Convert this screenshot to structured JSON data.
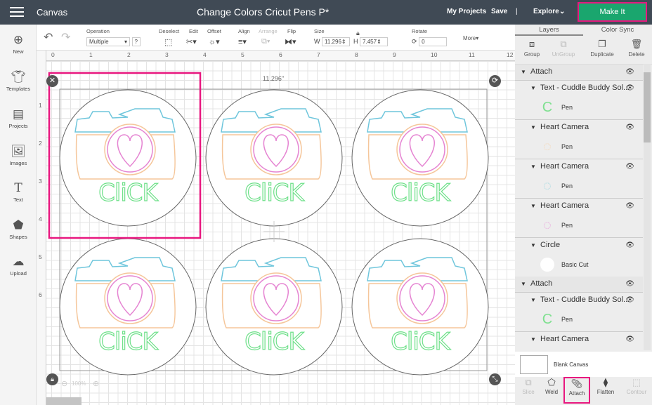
{
  "topbar": {
    "app": "Canvas",
    "title": "Change Colors Cricut Pens P*",
    "my_projects": "My Projects",
    "save": "Save",
    "separator": "|",
    "explore": "Explore",
    "make_it": "Make It",
    "accent": "#1aa66e",
    "highlight": "#e8177f"
  },
  "toolbar": {
    "operation_label": "Operation",
    "operation_value": "Multiple",
    "help": "?",
    "deselect": "Deselect",
    "edit": "Edit",
    "offset": "Offset",
    "align": "Align",
    "arrange": "Arrange",
    "flip": "Flip",
    "size": "Size",
    "w_label": "W",
    "w": "11.296",
    "h_label": "H",
    "h": "7.457",
    "rotate": "Rotate",
    "rotate_value": "0",
    "more": "More"
  },
  "sidebar": [
    {
      "label": "New",
      "icon": "plus-circle-icon"
    },
    {
      "label": "Templates",
      "icon": "shirt-icon"
    },
    {
      "label": "Projects",
      "icon": "projects-icon"
    },
    {
      "label": "Images",
      "icon": "image-icon"
    },
    {
      "label": "Text",
      "icon": "text-icon"
    },
    {
      "label": "Shapes",
      "icon": "shapes-icon"
    },
    {
      "label": "Upload",
      "icon": "cloud-upload-icon"
    }
  ],
  "ruler": {
    "top": [
      "0",
      "1",
      "2",
      "3",
      "4",
      "5",
      "6",
      "7",
      "8",
      "9",
      "10",
      "11",
      "12"
    ],
    "left": [
      "1",
      "2",
      "3",
      "4",
      "5",
      "6"
    ]
  },
  "canvas": {
    "width_readout": "11.296\"",
    "zoom": "100%",
    "design_text": "CliCK"
  },
  "panel": {
    "tabs": [
      "Layers",
      "Color Sync"
    ],
    "actions": [
      "Group",
      "UnGroup",
      "Duplicate",
      "Delete"
    ],
    "layers": [
      {
        "name": "Attach",
        "level": 0
      },
      {
        "name": "Text - Cuddle Buddy Sol...",
        "level": 1,
        "sub": "Pen",
        "swatch": "#7ee08f"
      },
      {
        "name": "Heart Camera",
        "level": 1,
        "sub": "Pen",
        "swatch": "#f5d6b3"
      },
      {
        "name": "Heart Camera",
        "level": 1,
        "sub": "Pen",
        "swatch": "#9fd8e0"
      },
      {
        "name": "Heart Camera",
        "level": 1,
        "sub": "Pen",
        "swatch": "#e9a3dc"
      },
      {
        "name": "Circle",
        "level": 1,
        "sub": "Basic Cut",
        "swatch": "#ffffff"
      },
      {
        "name": "Attach",
        "level": 0
      },
      {
        "name": "Text - Cuddle Buddy Sol...",
        "level": 1,
        "sub": "Pen",
        "swatch": "#7ee08f"
      },
      {
        "name": "Heart Camera",
        "level": 1
      }
    ],
    "blank_canvas": "Blank Canvas",
    "bottom": [
      "Slice",
      "Weld",
      "Attach",
      "Flatten",
      "Contour"
    ]
  }
}
